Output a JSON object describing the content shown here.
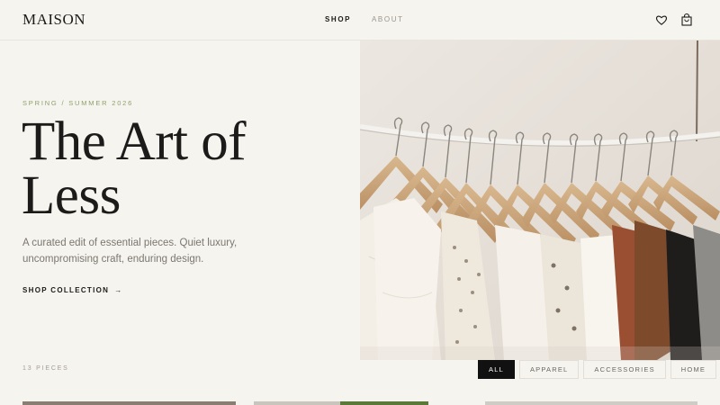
{
  "brand": {
    "logo": "MAISON"
  },
  "nav": {
    "shop": "SHOP",
    "about": "ABOUT"
  },
  "header_icons": [
    "heart-icon",
    "bag-icon"
  ],
  "hero": {
    "season": "SPRING / SUMMER 2026",
    "title_line1": "The Art of",
    "title_line2": "Less",
    "subtitle_line1": "A curated edit of essential pieces. Quiet luxury,",
    "subtitle_line2": "uncompromising craft, enduring design.",
    "cta": "SHOP COLLECTION",
    "cta_arrow": "→"
  },
  "catalog": {
    "count": "13 PIECES",
    "filters": [
      "ALL",
      "APPAREL",
      "ACCESSORIES",
      "HOME"
    ],
    "active_filter": "ALL"
  },
  "colors": {
    "background": "#f6f4ef",
    "accent_green": "#8fa06a",
    "text": "#1c1b19",
    "muted": "#7b7770"
  }
}
